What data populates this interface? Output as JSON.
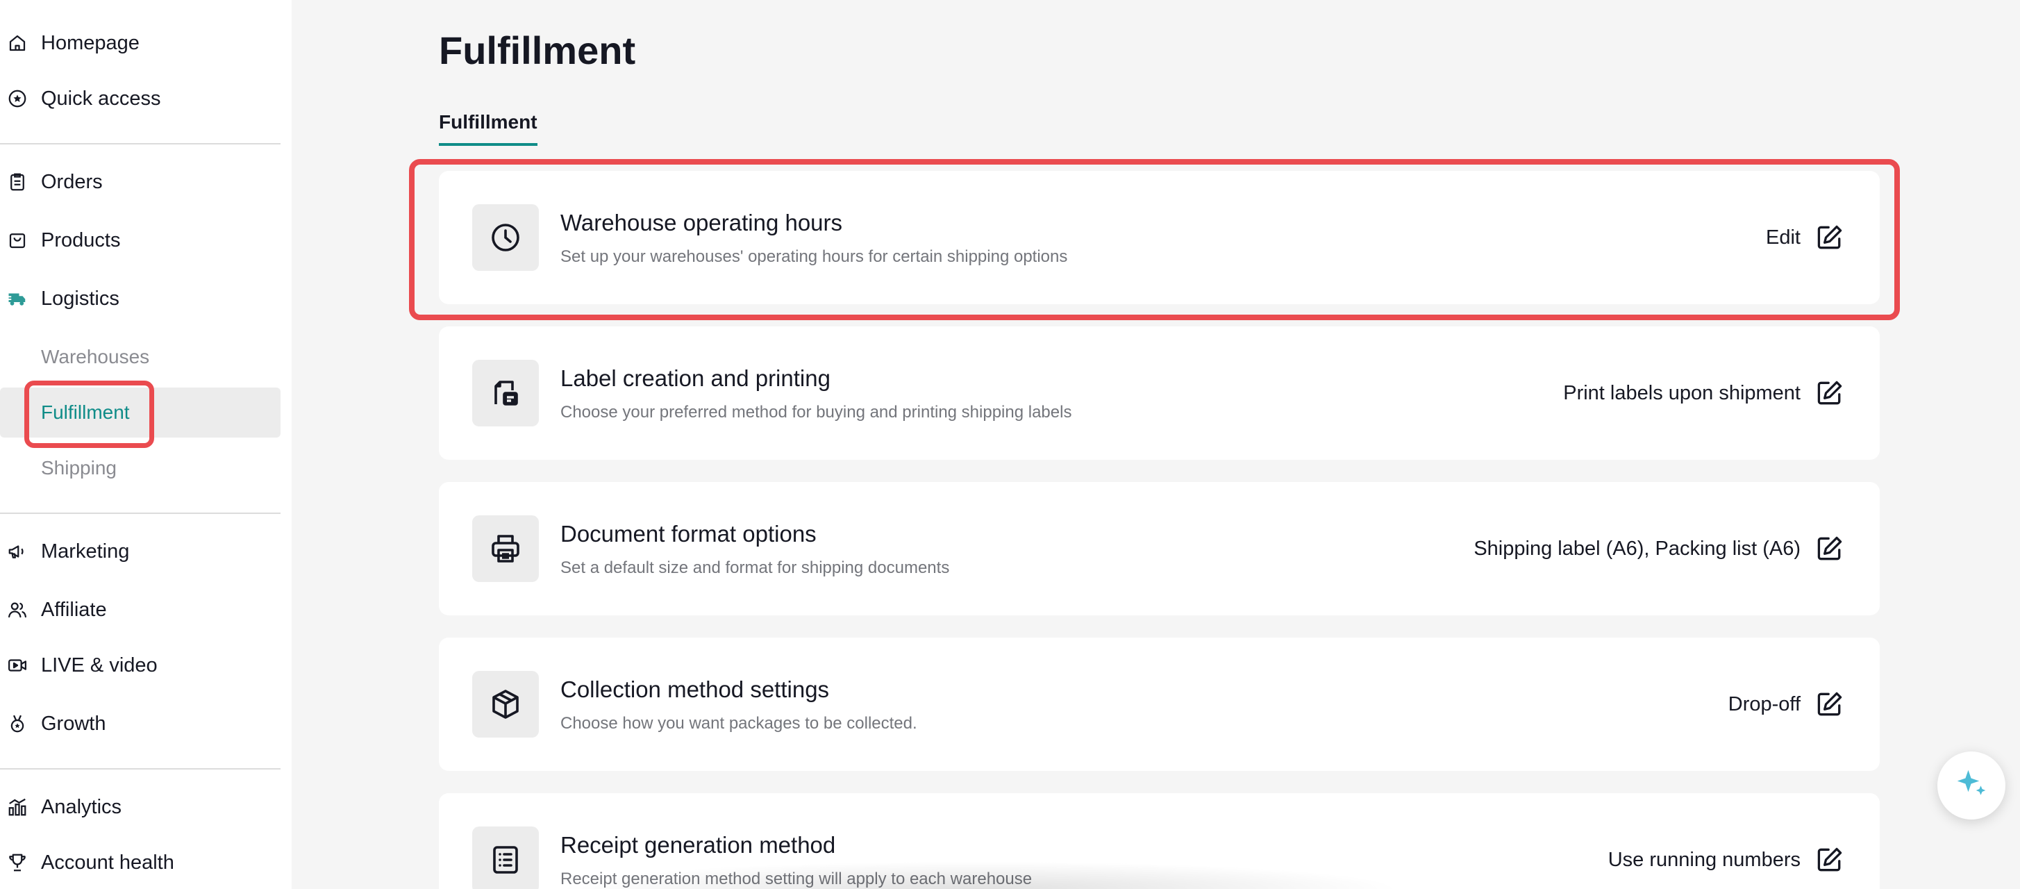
{
  "sidebar": {
    "homepage": "Homepage",
    "quick_access": "Quick access",
    "orders": "Orders",
    "products": "Products",
    "logistics": "Logistics",
    "warehouses": "Warehouses",
    "fulfillment": "Fulfillment",
    "shipping": "Shipping",
    "marketing": "Marketing",
    "affiliate": "Affiliate",
    "live_video": "LIVE & video",
    "growth": "Growth",
    "analytics": "Analytics",
    "account_health": "Account health"
  },
  "page": {
    "title": "Fulfillment",
    "tab": "Fulfillment"
  },
  "cards": [
    {
      "title": "Warehouse operating hours",
      "description": "Set up your warehouses' operating hours for certain shipping options",
      "action": "Edit",
      "icon": "clock-icon"
    },
    {
      "title": "Label creation and printing",
      "description": "Choose your preferred method for buying and printing shipping labels",
      "action": "Print labels upon shipment",
      "icon": "label-icon"
    },
    {
      "title": "Document format options",
      "description": "Set a default size and format for shipping documents",
      "action": "Shipping label (A6), Packing list (A6)",
      "icon": "printer-icon"
    },
    {
      "title": "Collection method settings",
      "description": "Choose how you want packages to be collected.",
      "action": "Drop-off",
      "icon": "package-icon"
    },
    {
      "title": "Receipt generation method",
      "description": "Receipt generation method setting will apply to each warehouse",
      "action": "Use running numbers",
      "icon": "receipt-icon"
    }
  ],
  "colors": {
    "accent": "#0f8c88",
    "highlight": "#ea4b4f",
    "logistics_icon": "#2e9b97",
    "fab_sparkle": "#4dbbd6"
  }
}
